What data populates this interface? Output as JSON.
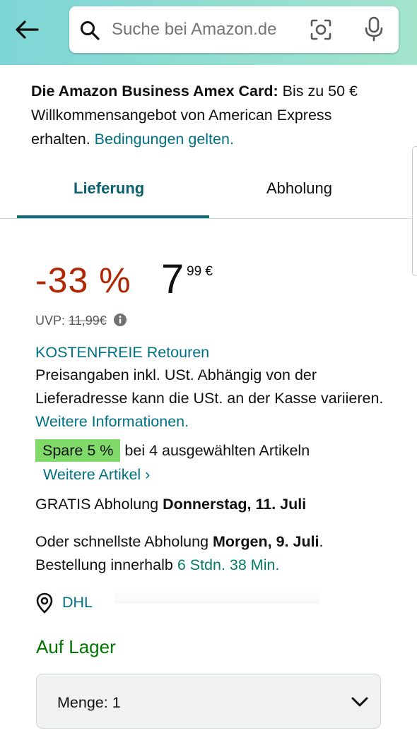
{
  "search": {
    "placeholder": "Suche bei Amazon.de"
  },
  "promo": {
    "bold": "Die Amazon Business Amex Card:",
    "text": " Bis zu 50 € Willkommensangebot von American Express erhalten. ",
    "link": "Bedingungen gelten."
  },
  "tabs": [
    {
      "label": "Lieferung",
      "active": true
    },
    {
      "label": "Abholung",
      "active": false
    }
  ],
  "price": {
    "discount": "-33 %",
    "whole": "7",
    "fraction": "99 €",
    "uvp_label": "UVP: ",
    "uvp_value": "11,99€"
  },
  "returns": "KOSTENFREIE Retouren",
  "tax": {
    "text": "Preisangaben inkl. USt. Abhängig von der Lieferadresse kann die USt. an der Kasse variieren. ",
    "link": "Weitere Informationen."
  },
  "spare": {
    "badge": "Spare 5 %",
    "text": "bei 4 ausgewählten Artikeln",
    "link": "Weitere Artikel ›"
  },
  "gratis": {
    "prefix": "GRATIS Abholung ",
    "date": "Donnerstag, 11. Juli"
  },
  "schnell": {
    "prefix": "Oder schnellste Abholung ",
    "date": "Morgen, 9. Juli",
    "suffix": ".",
    "order_prefix": "Bestellung innerhalb ",
    "countdown": "6 Stdn. 38 Min."
  },
  "pickup_point": "DHL",
  "stock": "Auf Lager",
  "quantity": {
    "label": "Menge:",
    "value": "1"
  },
  "colors": {
    "header_start": "#7ed6d6",
    "header_end": "#a3e4cd",
    "link": "#007185",
    "discount": "#b12704",
    "in_stock": "#007600",
    "badge": "#7fda6a"
  },
  "icons": [
    "back-arrow-icon",
    "search-icon",
    "camera-lens-icon",
    "microphone-icon",
    "info-icon",
    "location-pin-icon",
    "chevron-down-icon"
  ]
}
